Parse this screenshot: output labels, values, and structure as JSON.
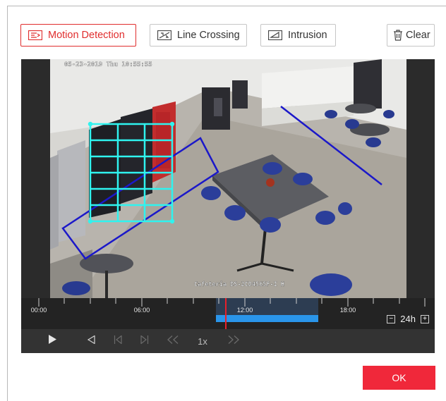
{
  "toolbar": {
    "motion_label": "Motion Detection",
    "line_label": "Line Crossing",
    "intrusion_label": "Intrusion",
    "clear_label": "Clear",
    "active_tool": "Motion Detection"
  },
  "video": {
    "osd_timestamp": "05-23-2019 Thu 10:55:55",
    "osd_camera": "Cafeteria DS-2CD4565F-I H"
  },
  "timeline": {
    "labels": [
      "00:00",
      "06:00",
      "12:00",
      "18:00"
    ],
    "zoom_label": "24h",
    "zoom_minus": "−",
    "zoom_plus": "+"
  },
  "playback": {
    "speed_label": "1x"
  },
  "footer": {
    "ok_label": "OK"
  },
  "colors": {
    "accent": "#e02d2d",
    "ok_button": "#f0283a",
    "motion_grid": "#2ff3ef",
    "line_rule": "#1b18c9",
    "record_bar": "#2a95ea",
    "playhead": "#e8202a"
  },
  "icons": {
    "motion": "motion-detection-icon",
    "line": "line-crossing-icon",
    "intrusion": "intrusion-icon",
    "clear": "trash-icon",
    "play": "play-icon",
    "prev_frame": "previous-frame-icon",
    "step_back": "step-back-icon",
    "step_forward": "step-forward-icon",
    "slow_down": "slow-down-icon",
    "speed_up": "speed-up-icon"
  }
}
